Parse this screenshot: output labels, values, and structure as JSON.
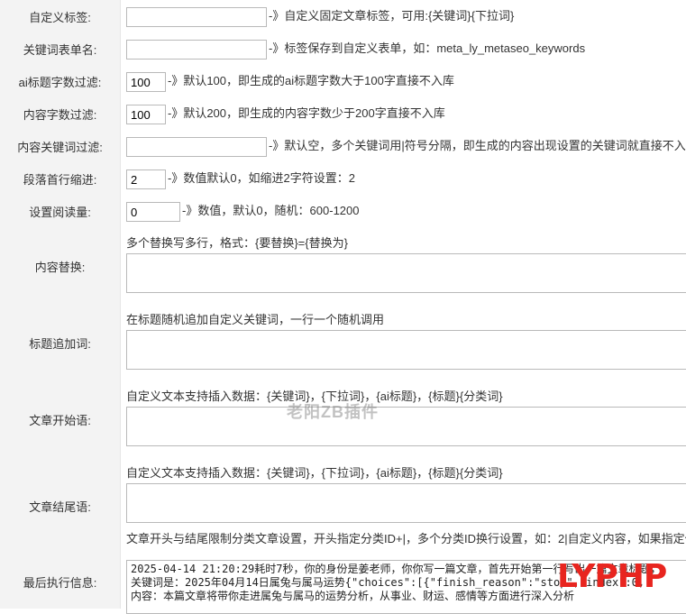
{
  "fields": [
    {
      "label": "自定义标签:",
      "value": "",
      "hint": "-》自定义固定文章标签，可用:{关键词}{下拉词}"
    },
    {
      "label": "关键词表单名:",
      "value": "",
      "hint": "-》标签保存到自定义表单，如：meta_ly_metaseo_keywords"
    },
    {
      "label": "ai标题字数过滤:",
      "value": "100",
      "hint": "-》默认100，即生成的ai标题字数大于100字直接不入库"
    },
    {
      "label": "内容字数过滤:",
      "value": "100",
      "hint": "-》默认200，即生成的内容字数少于200字直接不入库"
    },
    {
      "label": "内容关键词过滤:",
      "value": "",
      "hint": "-》默认空，多个关键词用|符号分隔，即生成的内容出现设置的关键词就直接不入库"
    },
    {
      "label": "段落首行缩进:",
      "value": "2",
      "hint": "-》数值默认0，如缩进2字符设置：2"
    },
    {
      "label": "设置阅读量:",
      "value": "0",
      "hint": "-》数值，默认0，随机：600-1200"
    }
  ],
  "areas": [
    {
      "label": "内容替换:",
      "note": "多个替换写多行，格式：{要替换}={替换为}"
    },
    {
      "label": "标题追加词:",
      "note": "在标题随机追加自定义关键词，一行一个随机调用"
    },
    {
      "label": "文章开始语:",
      "note": "自定义文本支持插入数据：{关键词}，{下拉词}，{ai标题}，{标题}{分类词}"
    },
    {
      "label": "文章结尾语:",
      "note": "自定义文本支持插入数据：{关键词}，{下拉词}，{ai标题}，{标题}{分类词}",
      "note2": "文章开头与结尾限制分类文章设置，开头指定分类ID+|，多个分类ID换行设置，如：2|自定义内容，如果指定作者"
    }
  ],
  "last_exec": {
    "label": "最后执行信息:",
    "line1": "2025-04-14 21:20:29耗时7秒，你的身份是姜老师，你你写一篇文章，首先开始第一行写出一篇文章标题，",
    "line2": "关键词是：2025年04月14日属兔与属马运势{\"choices\":[{\"finish_reason\":\"stop\",\"index\":0,",
    "line3": "内容：本篇文章将带你走进属兔与属马的运势分析，从事业、财运、感情等方面进行深入分析"
  },
  "watermark": "老阳ZB插件",
  "logo": "LYPHP"
}
